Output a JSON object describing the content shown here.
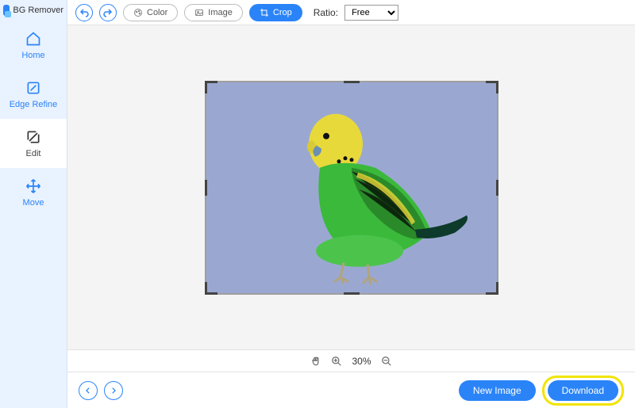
{
  "app": {
    "name": "BG Remover"
  },
  "sidebar": {
    "items": [
      {
        "label": "Home",
        "icon": "home-icon"
      },
      {
        "label": "Edge Refine",
        "icon": "edge-refine-icon"
      },
      {
        "label": "Edit",
        "icon": "edit-icon"
      },
      {
        "label": "Move",
        "icon": "move-icon"
      }
    ]
  },
  "toolbar": {
    "undo": "undo",
    "redo": "redo",
    "color_label": "Color",
    "image_label": "Image",
    "crop_label": "Crop",
    "ratio_label": "Ratio:",
    "ratio_value": "Free"
  },
  "canvas": {
    "subject": "green-and-yellow-parakeet",
    "background_color": "#9aa8d1"
  },
  "zoom": {
    "level": "30%"
  },
  "footer": {
    "new_image_label": "New Image",
    "download_label": "Download"
  },
  "colors": {
    "accent": "#2a84f8",
    "highlight": "#f2e400"
  }
}
